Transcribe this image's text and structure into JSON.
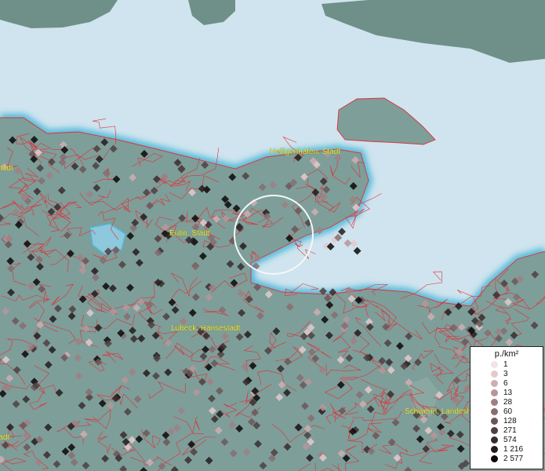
{
  "map": {
    "places": [
      {
        "name": "Heiligenhafen, Stadt"
      },
      {
        "name": "Eutin, Stadt"
      },
      {
        "name": "Lübeck, Hansestadt"
      },
      {
        "name": "Schwerin, Landeshauptstadt"
      },
      {
        "name": "Kiel, Landeshauptstadt"
      },
      {
        "name": "Rostock, Hansestadt"
      }
    ],
    "colors": {
      "sea": "#cfe4ee",
      "land": "#7e9e99",
      "boundaries": "#e0303a",
      "label": "#f2ef32"
    }
  },
  "legend": {
    "title": "p./km²",
    "classes": [
      {
        "label": "1",
        "color": "#f3e3e6"
      },
      {
        "label": "3",
        "color": "#e5c9cc"
      },
      {
        "label": "6",
        "color": "#cfaeb3"
      },
      {
        "label": "13",
        "color": "#b7959a"
      },
      {
        "label": "28",
        "color": "#a07f84"
      },
      {
        "label": "60",
        "color": "#886c70"
      },
      {
        "label": "128",
        "color": "#6c5659"
      },
      {
        "label": "271",
        "color": "#4f3f41"
      },
      {
        "label": "574",
        "color": "#382c2e"
      },
      {
        "label": "1 216",
        "color": "#231b1c"
      },
      {
        "label": "2 577",
        "color": "#0c0808"
      }
    ]
  }
}
